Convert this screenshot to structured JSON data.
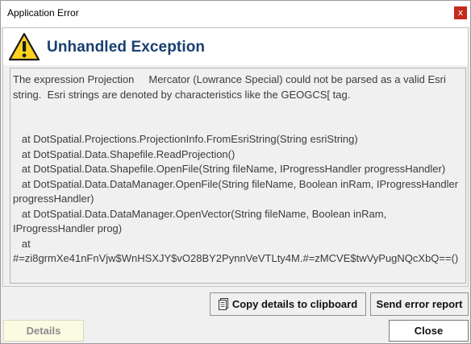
{
  "window": {
    "title": "Application Error",
    "close_glyph": "x"
  },
  "header": {
    "icon": "warning-icon",
    "title": "Unhandled Exception"
  },
  "error": {
    "message": "The expression Projection     Mercator (Lowrance Special) could not be parsed as a valid Esri string.  Esri strings are denoted by characteristics like the GEOGCS[ tag.\n\n\n   at DotSpatial.Projections.ProjectionInfo.FromEsriString(String esriString)\n   at DotSpatial.Data.Shapefile.ReadProjection()\n   at DotSpatial.Data.Shapefile.OpenFile(String fileName, IProgressHandler progressHandler)\n   at DotSpatial.Data.DataManager.OpenFile(String fileName, Boolean inRam, IProgressHandler progressHandler)\n   at DotSpatial.Data.DataManager.OpenVector(String fileName, Boolean inRam, IProgressHandler prog)\n   at #=zi8grmXe41nFnVjw$WnHSXJY$vO28BY2PynnVeVTLty4M.#=zMCVE$twVyPugNQcXbQ==()"
  },
  "buttons": {
    "copy_label": "Copy details to clipboard",
    "copy_icon": "clipboard-icon",
    "send_label": "Send error report",
    "details_label": "Details",
    "close_label": "Close"
  },
  "colors": {
    "header_title": "#1a3f6f",
    "close_button": "#c42b1c",
    "warning_fill": "#ffd21f",
    "details_bg": "#fbfbe3"
  }
}
